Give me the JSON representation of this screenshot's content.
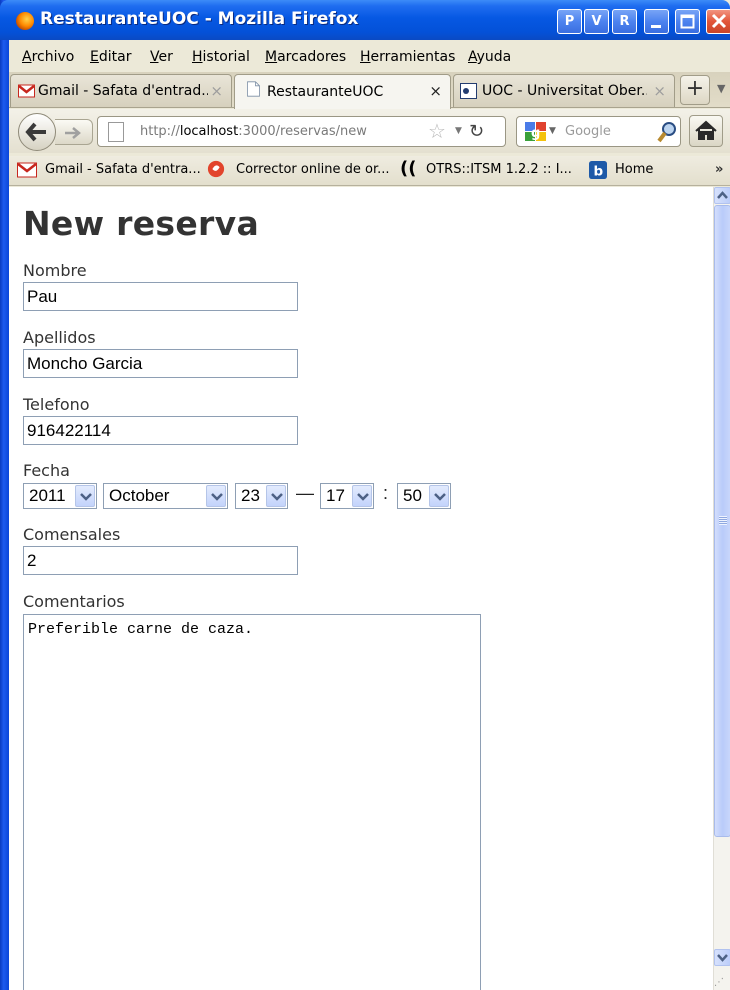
{
  "window": {
    "title": "RestauranteUOC - Mozilla Firefox",
    "buttons": {
      "p": "P",
      "v": "V",
      "r": "R"
    }
  },
  "menubar": {
    "items": [
      "Archivo",
      "Editar",
      "Ver",
      "Historial",
      "Marcadores",
      "Herramientas",
      "Ayuda"
    ]
  },
  "tabs": [
    {
      "label": "Gmail - Safata d'entrad...",
      "icon": "gmail-icon",
      "active": false
    },
    {
      "label": "RestauranteUOC",
      "icon": "page-icon",
      "active": true
    },
    {
      "label": "UOC - Universitat Ober...",
      "icon": "uoc-icon",
      "active": false
    }
  ],
  "tabbar": {
    "new_tab": "+",
    "close": "×"
  },
  "navbar": {
    "url_prefix": "http://",
    "url_host": "localhost",
    "url_rest": ":3000/reservas/new",
    "search_placeholder": "Google"
  },
  "bookmarks": [
    {
      "label": "Gmail - Safata d'entra...",
      "icon": "gmail-icon"
    },
    {
      "label": "Corrector online de or...",
      "icon": "corrector-icon"
    },
    {
      "label": "OTRS::ITSM 1.2.2 :: I...",
      "icon": "otrs-icon"
    },
    {
      "label": "Home",
      "icon": "home-b-icon"
    }
  ],
  "bookmarks_more": "»",
  "form": {
    "title": "New reserva",
    "nombre_label": "Nombre",
    "nombre_value": "Pau",
    "apellidos_label": "Apellidos",
    "apellidos_value": "Moncho Garcia",
    "telefono_label": "Telefono",
    "telefono_value": "916422114",
    "fecha_label": "Fecha",
    "fecha_year": "2011",
    "fecha_month": "October",
    "fecha_day": "23",
    "fecha_dash": "—",
    "fecha_hour": "17",
    "fecha_colon": ":",
    "fecha_minute": "50",
    "comensales_label": "Comensales",
    "comensales_value": "2",
    "comentarios_label": "Comentarios",
    "comentarios_value": "Preferible carne de caza."
  },
  "colors": {
    "titlebar": "#0658e3",
    "heading": "#333333",
    "input_border": "#8e9fb4",
    "select_arrow": "#c3d3fb"
  }
}
